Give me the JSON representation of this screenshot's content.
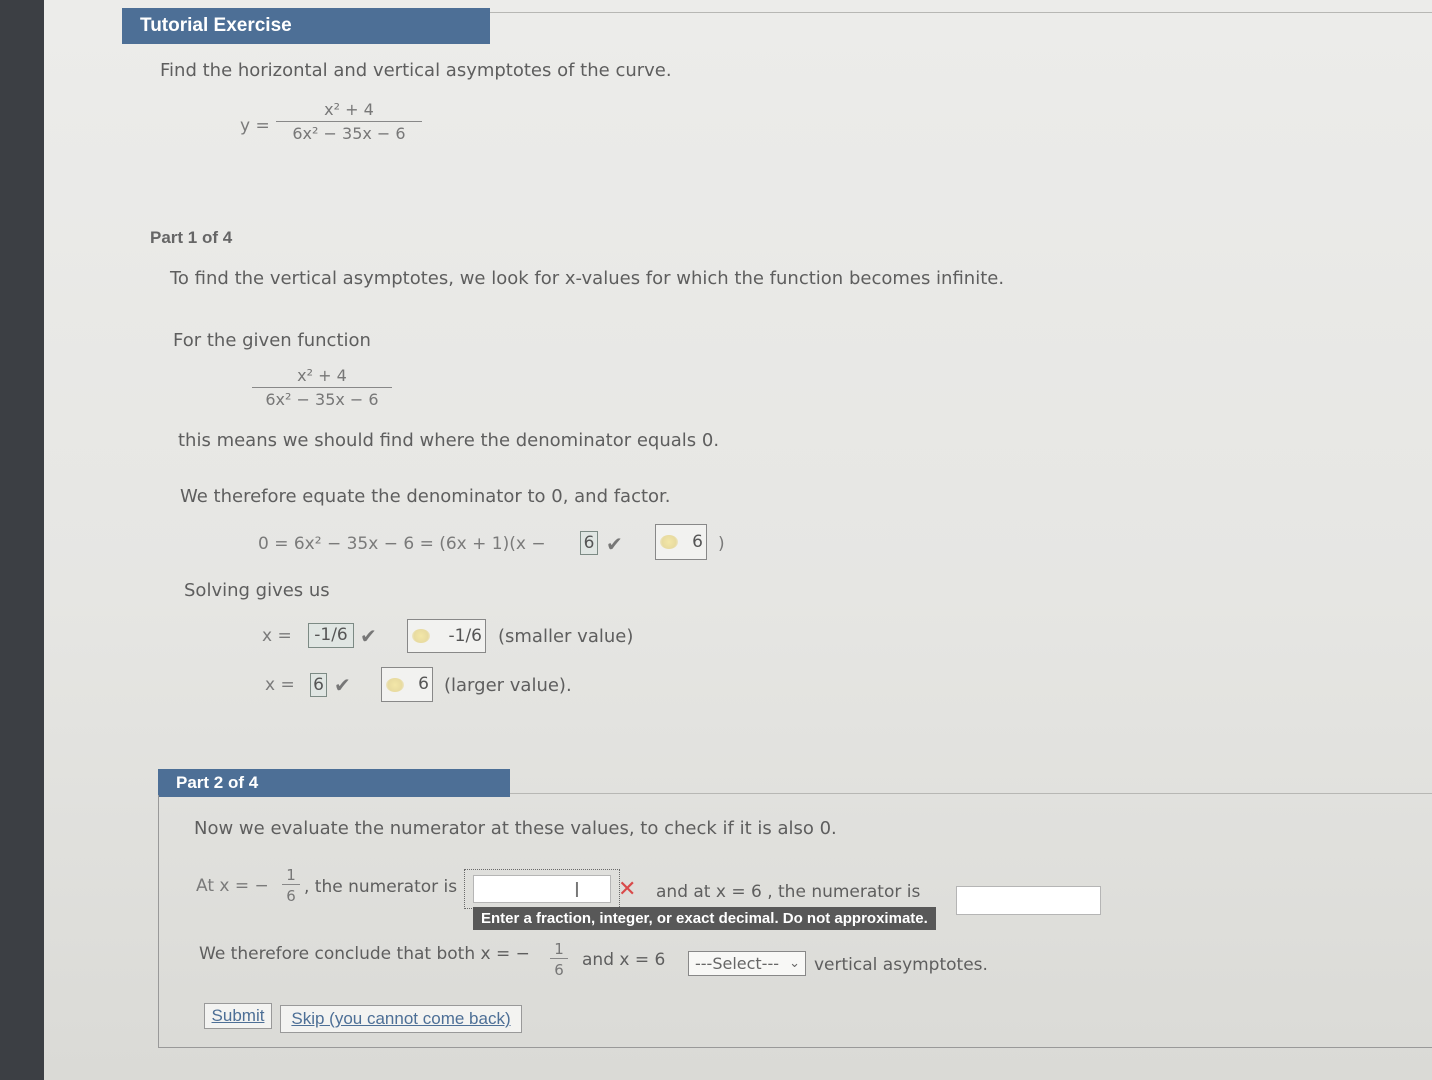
{
  "header": {
    "title": "Tutorial Exercise"
  },
  "problem": {
    "prompt": "Find the horizontal and vertical asymptotes of the curve.",
    "y_label": "y =",
    "numerator": "x² + 4",
    "denominator": "6x² − 35x − 6"
  },
  "part1": {
    "heading": "Part 1 of 4",
    "intro": "To find the vertical asymptotes, we look for x-values for which the function becomes infinite.",
    "given_label": "For the given function",
    "frac_num": "x² + 4",
    "frac_den": "6x² − 35x − 6",
    "denominator_note": "this means we should find where the denominator equals 0.",
    "equate_note": "We therefore equate the denominator to 0, and factor.",
    "factor_expr": "0 = 6x² − 35x − 6 = (6x + 1)(x −",
    "factor_answer": "6",
    "factor_correct": "6",
    "factor_close": ")",
    "solving_label": "Solving gives us",
    "x_eq": "x =",
    "small_answer": "-1/6",
    "small_correct": "-1/6",
    "small_note": "(smaller value)",
    "large_answer": "6",
    "large_correct": "6",
    "large_note": "(larger value)."
  },
  "part2": {
    "heading": "Part 2 of 4",
    "intro": "Now we evaluate the numerator at these values, to check if it is also 0.",
    "at_label": "At x = −",
    "frac1_num": "1",
    "frac1_den": "6",
    "numerator_text": ", the numerator is",
    "numerator_input_value": "",
    "and_at_text": "and at x = 6 , the numerator is",
    "numerator2_input_value": "",
    "tooltip": "Enter a fraction, integer, or exact decimal. Do not approximate.",
    "conclude_text": "We therefore conclude that both x = −",
    "frac2_num": "1",
    "frac2_den": "6",
    "and_x6": "and x = 6",
    "select_value": "---Select---",
    "vertical_text": "vertical asymptotes.",
    "submit_label": "Submit",
    "skip_label": "Skip (you cannot come back)"
  },
  "icons": {
    "check": "check-icon",
    "error": "x-error-icon",
    "key": "key-icon",
    "dropdown": "chevron-down-icon",
    "cursor": "text-cursor-icon"
  }
}
